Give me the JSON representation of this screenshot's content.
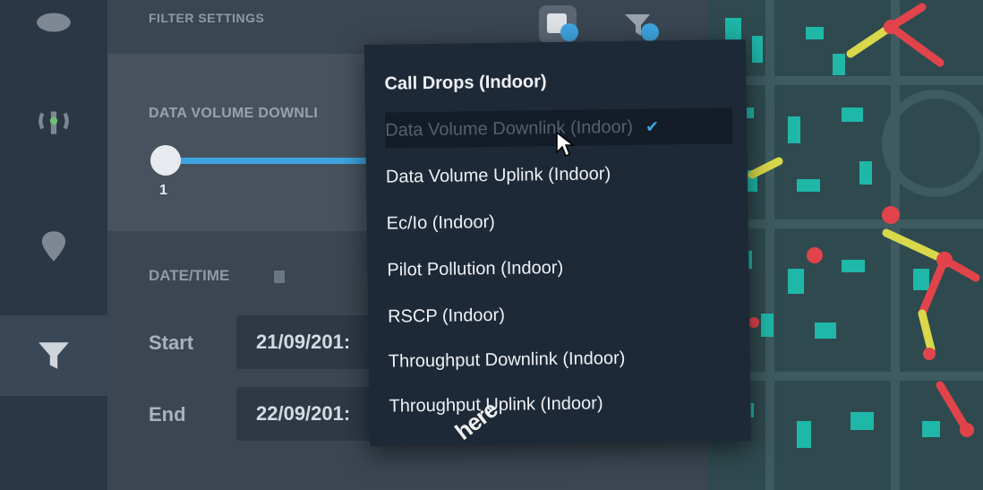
{
  "header": {
    "title": "FILTER SETTINGS",
    "accent_color": "#3ea4e0",
    "icons": [
      "layers-icon",
      "filter-icon"
    ]
  },
  "sidebar": {
    "items": [
      {
        "icon": "eye-icon"
      },
      {
        "icon": "antenna-icon"
      },
      {
        "icon": "location-pin-icon"
      },
      {
        "icon": "filter-icon",
        "active": true
      }
    ]
  },
  "metric": {
    "label": "DATA VOLUME DOWNLI",
    "slider_value": "1"
  },
  "datetime": {
    "title": "DATE/TIME",
    "start_label": "Start",
    "start_value": "21/09/201:",
    "end_label": "End",
    "end_value": "22/09/201:"
  },
  "dropdown": {
    "options": [
      "Call Drops (Indoor)",
      "Data Volume Downlink (Indoor)",
      "Data Volume Uplink (Indoor)",
      "Ec/Io (Indoor)",
      "Pilot Pollution (Indoor)",
      "RSCP (Indoor)",
      "Throughput Downlink (Indoor)",
      "Throughput Uplink (Indoor)"
    ],
    "selected_index": 1
  },
  "watermark": "here"
}
